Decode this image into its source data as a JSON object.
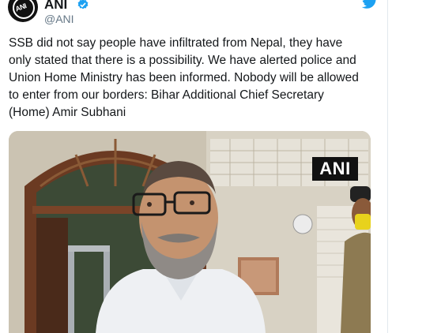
{
  "tweet": {
    "author_name": "ANI",
    "author_handle": "@ANI",
    "avatar_logo_text": "ANI",
    "text": "SSB did not say people have infiltrated from Nepal, they have\nonly stated that there is a possibility. We have alerted police and\nUnion Home Ministry has been informed. Nobody will be allowed\nto enter from our borders: Bihar Additional Chief Secretary\n(Home) Amir Subhani"
  },
  "media": {
    "watermark": "ANI"
  },
  "icons": {
    "verified": "verified-badge-icon",
    "platform": "twitter-bird-icon"
  },
  "colors": {
    "twitter_blue": "#1da1f2",
    "handle_gray": "#657786",
    "text_dark": "#14171a"
  }
}
